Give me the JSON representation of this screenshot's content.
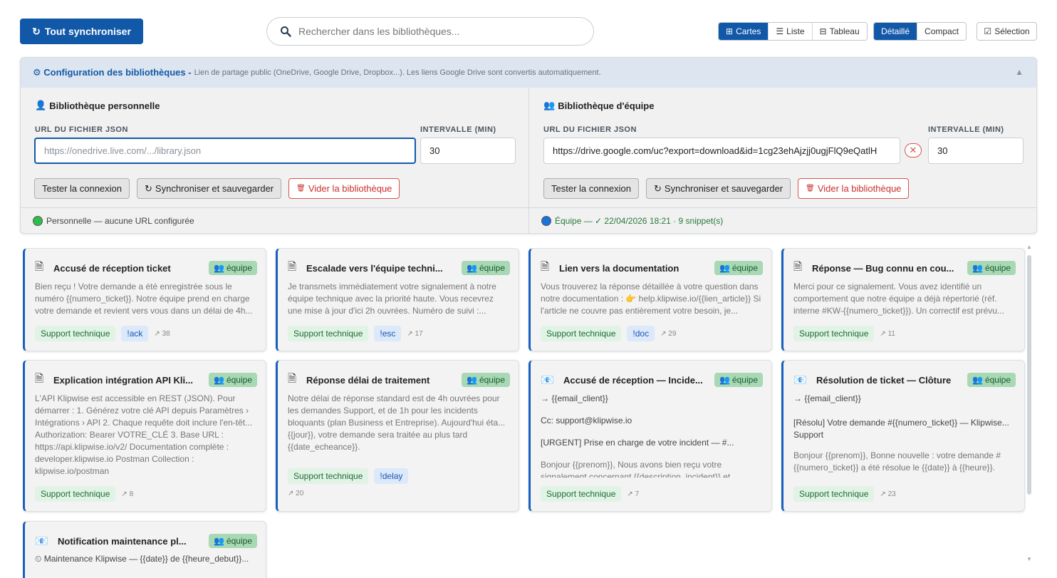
{
  "toolbar": {
    "sync_all_icon": "↻",
    "sync_all_label": "Tout synchroniser",
    "search_placeholder": "Rechercher dans les bibliothèques...",
    "view_modes": [
      {
        "icon": "⊞",
        "label": "Cartes",
        "active": true
      },
      {
        "icon": "☰",
        "label": "Liste",
        "active": false
      },
      {
        "icon": "⊟",
        "label": "Tableau",
        "active": false
      }
    ],
    "density_modes": [
      {
        "label": "Détaillé",
        "active": true
      },
      {
        "label": "Compact",
        "active": false
      }
    ],
    "selection_icon": "☑",
    "selection_label": "Sélection"
  },
  "config": {
    "icon": "⚙",
    "title": "Configuration des bibliothèques -",
    "description": "Lien de partage public (OneDrive, Google Drive, Dropbox...). Les liens Google Drive sont convertis automatiquement.",
    "toggle_icon": "▲",
    "personal": {
      "icon": "👤",
      "title": "Bibliothèque personnelle",
      "url_label": "URL DU FICHIER JSON",
      "url_placeholder": "https://onedrive.live.com/.../library.json",
      "url_value": "",
      "interval_label": "INTERVALLE (MIN)",
      "interval_value": "30",
      "test_label": "Tester la connexion",
      "sync_icon": "↻",
      "sync_label": "Synchroniser et sauvegarder",
      "clear_icon": "🗑",
      "clear_label": "Vider la bibliothèque",
      "status_text": "Personnelle — aucune URL configurée"
    },
    "team": {
      "icon": "👥",
      "title": "Bibliothèque d'équipe",
      "url_label": "URL DU FICHIER JSON",
      "url_value": "https://drive.google.com/uc?export=download&id=1cg23ehAjzjj0ugjFlQ9eQatlH",
      "clear_x": "✕",
      "interval_label": "INTERVALLE (MIN)",
      "interval_value": "30",
      "test_label": "Tester la connexion",
      "sync_icon": "↻",
      "sync_label": "Synchroniser et sauvegarder",
      "clear_icon": "🗑",
      "clear_label": "Vider la bibliothèque",
      "status_text": "Équipe — ✓ 22/04/2026 18:21 · 9 snippet(s)"
    }
  },
  "badge_label": "équipe",
  "badge_icon": "👥",
  "cards": [
    {
      "title": "Accusé de réception ticket",
      "body": [
        "Bien reçu ! Votre demande a été enregistrée sous le numéro {{numero_ticket}}. Notre équipe prend en charge votre demande et revient vers vous dans un délai de 4h..."
      ],
      "tag": "Support technique",
      "shortcut": "!ack",
      "uses": "↗ 38"
    },
    {
      "title": "Escalade vers l'équipe techni...",
      "body": [
        "Je transmets immédiatement votre signalement à notre équipe technique avec la priorité haute. Vous recevrez une mise à jour d'ici 2h ouvrées. Numéro de suivi :..."
      ],
      "tag": "Support technique",
      "shortcut": "!esc",
      "uses": "↗ 17"
    },
    {
      "title": "Lien vers la documentation",
      "body": [
        "Vous trouverez la réponse détaillée à votre question dans notre documentation : 👉 help.klipwise.io/{{lien_article}} Si l'article ne couvre pas entièrement votre besoin, je..."
      ],
      "tag": "Support technique",
      "shortcut": "!doc",
      "uses": "↗ 29"
    },
    {
      "title": "Réponse — Bug connu en cou...",
      "body": [
        "Merci pour ce signalement. Vous avez identifié un comportement que notre équipe a déjà répertorié (réf. interne #KW-{{numero_ticket}}). Un correctif est prévu..."
      ],
      "tag": "Support technique",
      "shortcut": "",
      "uses": "↗ 11"
    },
    {
      "title": "Explication intégration API Kli...",
      "body": [
        "L'API Klipwise est accessible en REST (JSON). Pour démarrer : 1. Générez votre clé API depuis Paramètres › Intégrations › API 2. Chaque requête doit inclure l'en-têt... Authorization: Bearer VOTRE_CLÉ 3. Base URL : https://api.klipwise.io/v2/ Documentation complète : developer.klipwise.io Postman Collection : klipwise.io/postman"
      ],
      "tag": "Support technique",
      "shortcut": "",
      "uses": "↗ 8"
    },
    {
      "title": "Réponse délai de traitement",
      "body": [
        "Notre délai de réponse standard est de 4h ouvrées pour les demandes Support, et de 1h pour les incidents bloquants (plan Business et Entreprise). Aujourd'hui éta... {{jour}}, votre demande sera traitée au plus tard {{date_echeance}}."
      ],
      "tag": "Support technique",
      "shortcut": "!delay",
      "uses": "↗ 20"
    },
    {
      "title": "Accusé de réception — Incide...",
      "body": [
        "→ {{email_client}}",
        "Cc: support@klipwise.io",
        "[URGENT] Prise en charge de votre incident — #... {{numero_ticket}}",
        "Bonjour {{prenom}}, Nous avons bien reçu votre signalement concernant {{description_incident}} et..."
      ],
      "tag": "Support technique",
      "shortcut": "",
      "uses": "↗ 7"
    },
    {
      "title": "Résolution de ticket — Clôture",
      "body": [
        "→ {{email_client}}",
        "[Résolu] Votre demande #{{numero_ticket}} — Klipwise... Support",
        "Bonjour {{prenom}}, Bonne nouvelle : votre demande # {{numero_ticket}} a été résolue le {{date}} à {{heure}}."
      ],
      "tag": "Support technique",
      "shortcut": "",
      "uses": "↗ 23"
    },
    {
      "title": "Notification maintenance pl...",
      "body": [
        "⏲ Maintenance Klipwise — {{date}} de {{heure_debut}}..."
      ],
      "tag": "",
      "shortcut": "",
      "uses": ""
    }
  ]
}
